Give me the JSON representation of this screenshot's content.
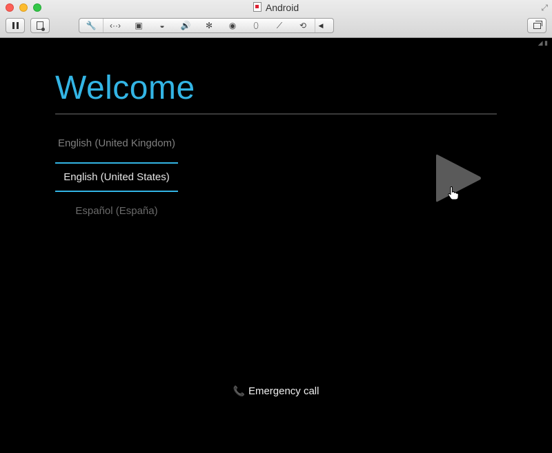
{
  "window": {
    "title": "Android"
  },
  "toolbar": {
    "pause_icon": "pause-icon",
    "snapshot_icon": "snapshot-icon",
    "group_icons": [
      {
        "name": "wrench-icon",
        "glyph": "🔧"
      },
      {
        "name": "network-icon",
        "glyph": "‹··›"
      },
      {
        "name": "hard-disk-icon",
        "glyph": "▣"
      },
      {
        "name": "optical-drive-icon",
        "glyph": "◒"
      },
      {
        "name": "sound-icon",
        "glyph": "🔊"
      },
      {
        "name": "bluetooth-icon",
        "glyph": "✻"
      },
      {
        "name": "camera-icon",
        "glyph": "◉"
      },
      {
        "name": "mouse-icon",
        "glyph": "⬯"
      },
      {
        "name": "usb-icon",
        "glyph": "⟋"
      },
      {
        "name": "sync-icon",
        "glyph": "⟲"
      }
    ],
    "collapse_icon": "triangle-left-icon",
    "window_mode_icon": "window-mode-icon"
  },
  "screen": {
    "welcome_title": "Welcome",
    "languages": [
      {
        "label": "English (United Kingdom)",
        "selected": false
      },
      {
        "label": "English (United States)",
        "selected": true
      },
      {
        "label": "Español (España)",
        "selected": false
      }
    ],
    "next_icon": "play-arrow-icon",
    "emergency_call_label": "Emergency call",
    "emergency_icon": "phone-icon"
  },
  "colors": {
    "accent": "#33b5e5",
    "background": "#000000",
    "next_button": "#5a5a5a"
  }
}
